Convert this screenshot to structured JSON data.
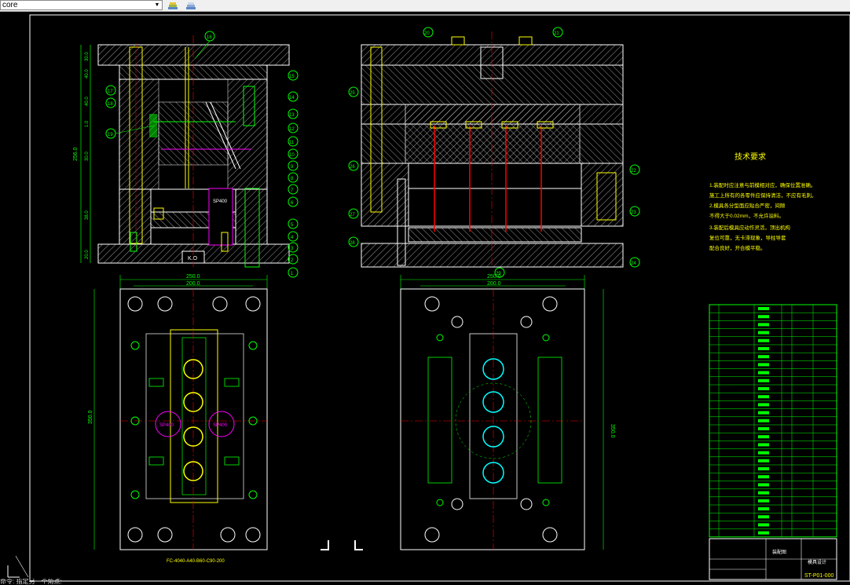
{
  "toolbar": {
    "layer_value": "core",
    "layer_state_icon": "layer-state-icon",
    "layers_icon": "layers-icon"
  },
  "drawing": {
    "top_view_dims": {
      "vertical_total": "256.0",
      "v1": "30.0",
      "v2": "40.0",
      "v3": "1.0",
      "v4": "30.0",
      "v5": "38.0",
      "v6": "20.0"
    },
    "plate_width_outer": "250.0",
    "plate_width_inner": "200.0",
    "plate_height": "350.0",
    "spacer_label": "SP400",
    "ko_label": "K.O",
    "part_labels_left": [
      "15",
      "14",
      "13",
      "12",
      "11",
      "10",
      "9",
      "8",
      "7",
      "6",
      "5",
      "4",
      "3",
      "2",
      "1"
    ],
    "part_labels_left_side": [
      "17",
      "18",
      "19"
    ],
    "part_labels_top_right": [
      "20",
      "21"
    ],
    "part_labels_right_left": [
      "25",
      "26",
      "27",
      "28"
    ],
    "part_labels_right_right": [
      "22",
      "23",
      "24"
    ],
    "part_label_bottom_right": "29",
    "part_label_16": "16",
    "plan_label_left": "FC-4040-A40-B60-C90-200",
    "spacer_plan_labels": [
      "SP400",
      "SP400"
    ],
    "tech_title": "技术要求",
    "tech_lines": [
      "1.装配时应注意与前模相对应，确保位置准确。",
      "施工上所有的各零件应保持清洁，不应有毛刺。",
      "2.模具各分型面应贴合严密，间隙",
      "不得大于0.02mm，不允许溢料。",
      "3.装配后模具应动作灵活，顶出机构",
      "复位可靠，无卡滞现象，导柱导套",
      "配合良好，开合模平稳。"
    ],
    "title_block_name": "装配图",
    "title_block_code": "ST-P01-000",
    "title_block_org": "模具设计"
  },
  "cmdline": {
    "text": "命令: 指定另一个角点:"
  },
  "colors": {
    "yellow_line": "#ffff00",
    "green_line": "#00ff00",
    "white_line": "#ffffff",
    "red_line": "#ff0000",
    "magenta_line": "#ff00ff",
    "cyan_line": "#00ffff"
  }
}
